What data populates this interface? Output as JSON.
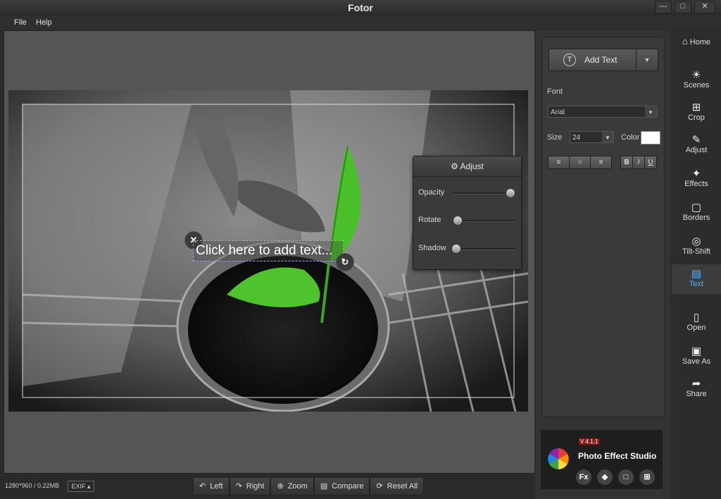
{
  "window": {
    "title": "Fotor"
  },
  "menu": [
    "File",
    "Help"
  ],
  "canvas": {
    "overlay_text": "Click here to add text..."
  },
  "adjust_panel": {
    "title": "Adjust",
    "sliders": [
      {
        "label": "Opacity",
        "value": 1.0
      },
      {
        "label": "Rotate",
        "value": 0.0
      },
      {
        "label": "Shadow",
        "value": 0.0
      }
    ]
  },
  "status": {
    "info": "1280*960 / 0.22MB",
    "exif": "EXIF"
  },
  "toolbar": [
    "Left",
    "Right",
    "Zoom",
    "Compare",
    "Reset All"
  ],
  "text_panel": {
    "add_text_label": "Add Text",
    "font_label": "Font",
    "font_value": "Arial",
    "size_label": "Size",
    "size_value": "24",
    "color_label": "Color",
    "color_value": "#ffffff",
    "style_buttons": [
      "B",
      "I",
      "U"
    ]
  },
  "sidebar": [
    "Home",
    "Scenes",
    "Crop",
    "Adjust",
    "Effects",
    "Borders",
    "Tilt-Shift",
    "Text",
    "Open",
    "Save As",
    "Share"
  ],
  "sidebar_active": "Text",
  "promo": {
    "version": "V 4.1.1",
    "name": "Photo Effect Studio",
    "fx_label": "Fx"
  },
  "colors": {
    "accent": "#5ab0ff",
    "leaf": "#49c02a"
  }
}
